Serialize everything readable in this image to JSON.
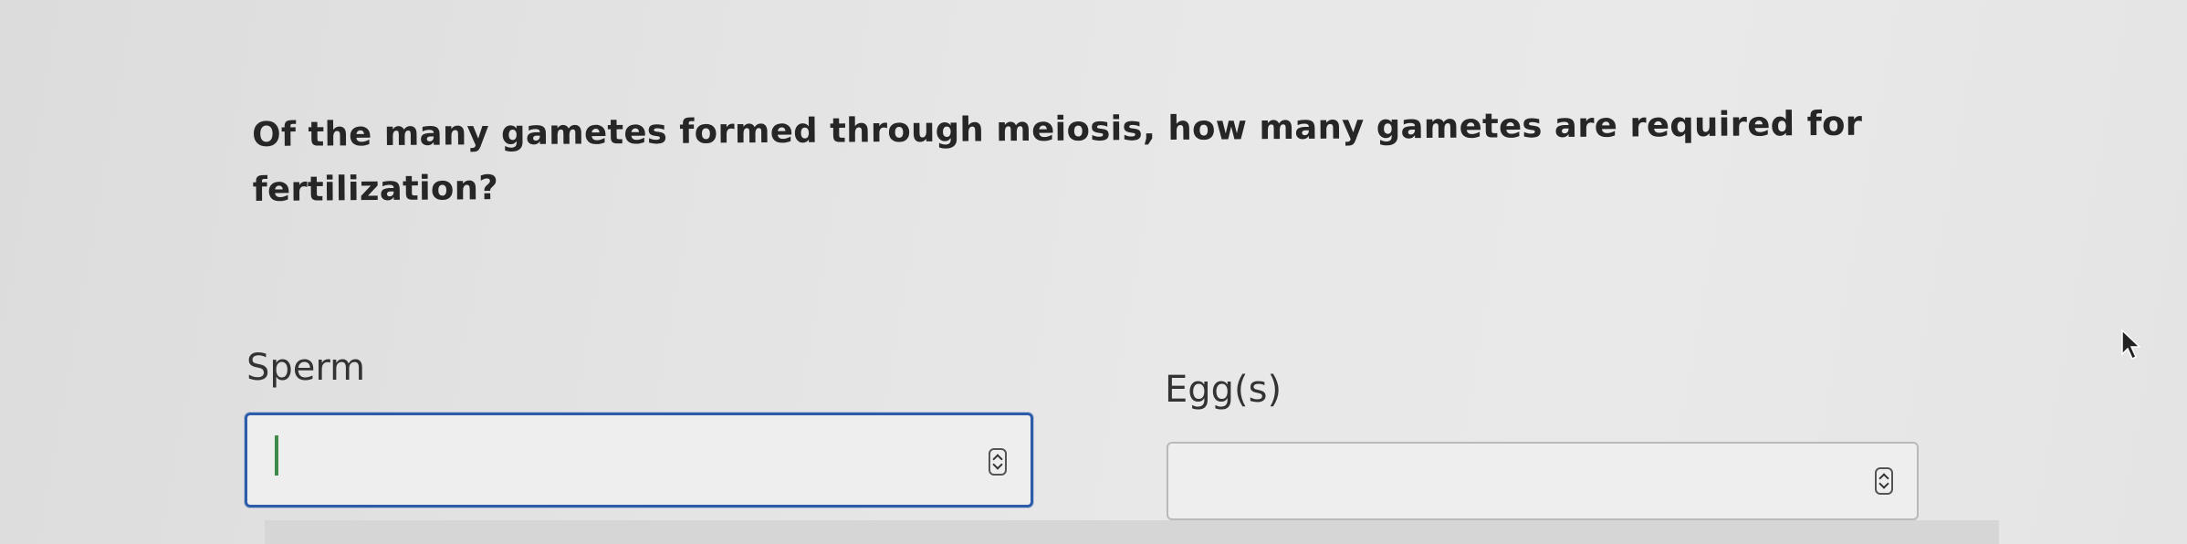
{
  "question": {
    "text": "Of the many gametes formed through meiosis, how many gametes are required for fertilization?"
  },
  "fields": {
    "sperm": {
      "label": "Sperm",
      "value": ""
    },
    "eggs": {
      "label": "Egg(s)",
      "value": ""
    }
  },
  "icons": {
    "spinner": "up-down-chevron-icon",
    "cursor": "mouse-pointer-icon"
  },
  "colors": {
    "focus_border": "#2b5da9",
    "caret": "#3f8a48",
    "text": "#262626"
  }
}
